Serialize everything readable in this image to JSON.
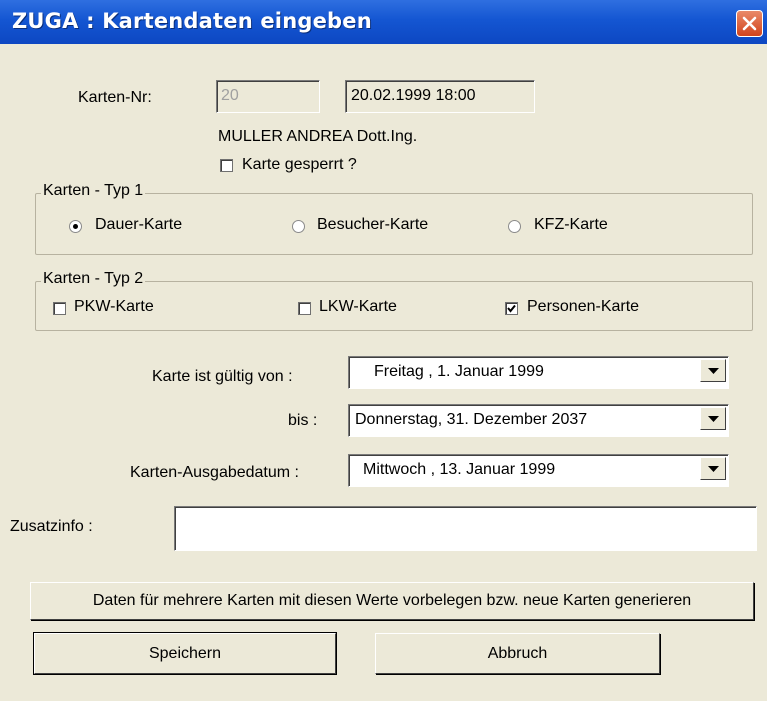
{
  "window": {
    "title": "ZUGA : Kartendaten eingeben"
  },
  "card": {
    "number_label": "Karten-Nr:",
    "number_value": "20",
    "timestamp": "20.02.1999 18:00",
    "holder": "MULLER ANDREA  Dott.Ing.",
    "blocked_label": "Karte gesperrt ?",
    "blocked_checked": false
  },
  "type1": {
    "title": "Karten - Typ 1",
    "options": [
      {
        "label": "Dauer-Karte",
        "selected": true
      },
      {
        "label": "Besucher-Karte",
        "selected": false
      },
      {
        "label": "KFZ-Karte",
        "selected": false
      }
    ]
  },
  "type2": {
    "title": "Karten - Typ 2",
    "options": [
      {
        "label": "PKW-Karte",
        "checked": false
      },
      {
        "label": "LKW-Karte",
        "checked": false
      },
      {
        "label": "Personen-Karte",
        "checked": true
      }
    ]
  },
  "dates": {
    "valid_from_label": "Karte ist gültig von  :",
    "valid_from_value": "Freitag   ,  1.   Januar   1999",
    "until_label": "bis :",
    "until_value": "Donnerstag, 31. Dezember 2037",
    "issue_label": "Karten-Ausgabedatum :",
    "issue_value": "Mittwoch  , 13.   Januar   1999"
  },
  "extra": {
    "label": "Zusatzinfo :",
    "value": ""
  },
  "buttons": {
    "generate": "Daten für mehrere Karten mit diesen Werte vorbelegen bzw. neue Karten generieren",
    "save": "Speichern",
    "cancel": "Abbruch"
  },
  "colors": {
    "titlebar": "#1456d2",
    "dialog_bg": "#ece9d8",
    "close_button": "#d2441d"
  }
}
